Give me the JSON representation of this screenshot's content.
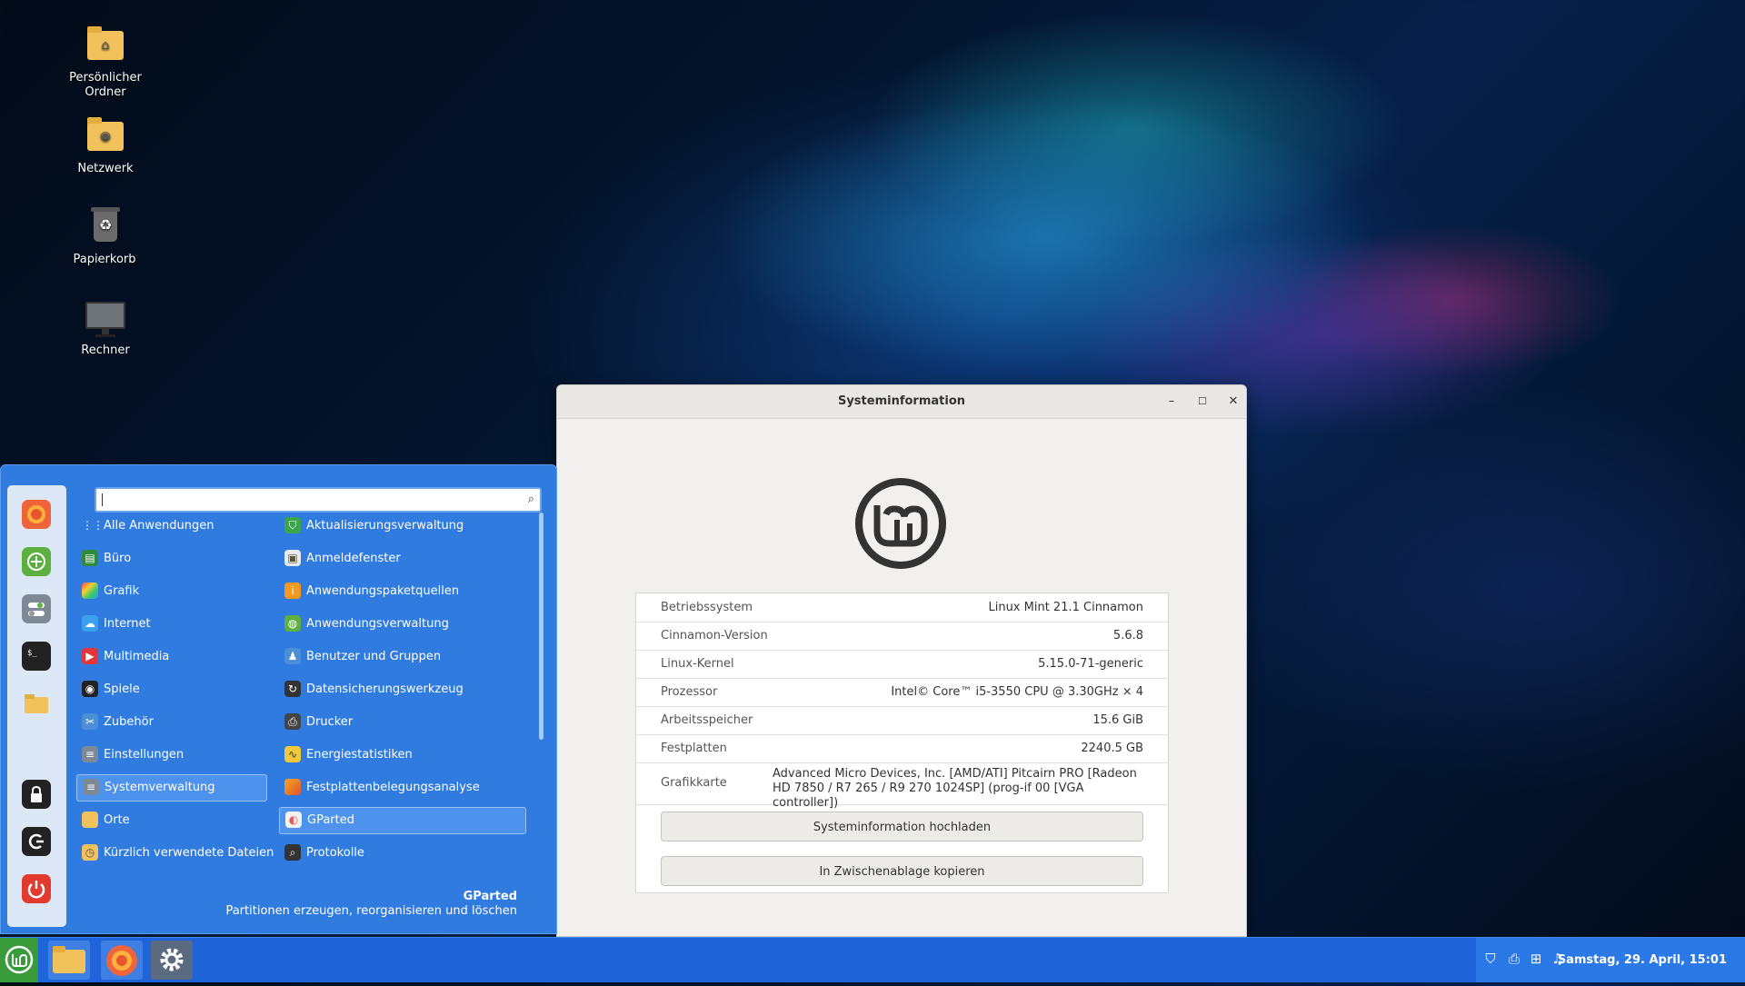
{
  "desktop": {
    "icons": [
      {
        "label": "Persönlicher Ordner",
        "icon": "home-folder-icon"
      },
      {
        "label": "Netzwerk",
        "icon": "network-folder-icon"
      },
      {
        "label": "Papierkorb",
        "icon": "trash-icon"
      },
      {
        "label": "Rechner",
        "icon": "computer-icon"
      }
    ]
  },
  "window": {
    "title": "Systeminformation",
    "rows": [
      {
        "key": "Betriebssystem",
        "value": "Linux Mint 21.1 Cinnamon"
      },
      {
        "key": "Cinnamon-Version",
        "value": "5.6.8"
      },
      {
        "key": "Linux-Kernel",
        "value": "5.15.0-71-generic"
      },
      {
        "key": "Prozessor",
        "value": "Intel© Core™ i5-3550 CPU @ 3.30GHz × 4"
      },
      {
        "key": "Arbeitsspeicher",
        "value": "15.6 GiB"
      },
      {
        "key": "Festplatten",
        "value": "2240.5 GB"
      },
      {
        "key": "Grafikkarte",
        "value": "Advanced Micro Devices, Inc. [AMD/ATI] Pitcairn PRO [Radeon HD 7850 / R7 265 / R9 270 1024SP] (prog-if 00 [VGA controller])"
      }
    ],
    "upload_button": "Systeminformation hochladen",
    "copy_button": "In Zwischenablage kopieren"
  },
  "menu": {
    "search_value": "",
    "categories": [
      "Alle Anwendungen",
      "Büro",
      "Grafik",
      "Internet",
      "Multimedia",
      "Spiele",
      "Zubehör",
      "Einstellungen",
      "Systemverwaltung",
      "Orte",
      "Kürzlich verwendete Dateien"
    ],
    "selected_category": "Systemverwaltung",
    "apps": [
      "Aktualisierungsverwaltung",
      "Anmeldefenster",
      "Anwendungspaketquellen",
      "Anwendungsverwaltung",
      "Benutzer und Gruppen",
      "Datensicherungswerkzeug",
      "Drucker",
      "Energiestatistiken",
      "Festplattenbelegungsanalyse",
      "GParted",
      "Protokolle"
    ],
    "selected_app": "GParted",
    "description_title": "GParted",
    "description_text": "Partitionen erzeugen, reorganisieren und löschen",
    "favorites": [
      "firefox-icon",
      "software-manager-icon",
      "settings-toggle-icon",
      "terminal-icon",
      "files-folder-icon"
    ],
    "session": [
      "lock-icon",
      "logout-icon",
      "power-icon"
    ]
  },
  "taskbar": {
    "launchers": [
      "mint-menu-icon",
      "files-folder-icon",
      "firefox-icon",
      "settings-gear-icon"
    ],
    "tray": [
      "shield-icon",
      "printer-icon",
      "network-icon",
      "sound-icon"
    ],
    "clock": "Samstag, 29. April, 15:01"
  },
  "colors": {
    "menu_bg": "#2f7be0",
    "taskbar_bg": "#1f64d8",
    "mint_green": "#3a9b3a"
  }
}
